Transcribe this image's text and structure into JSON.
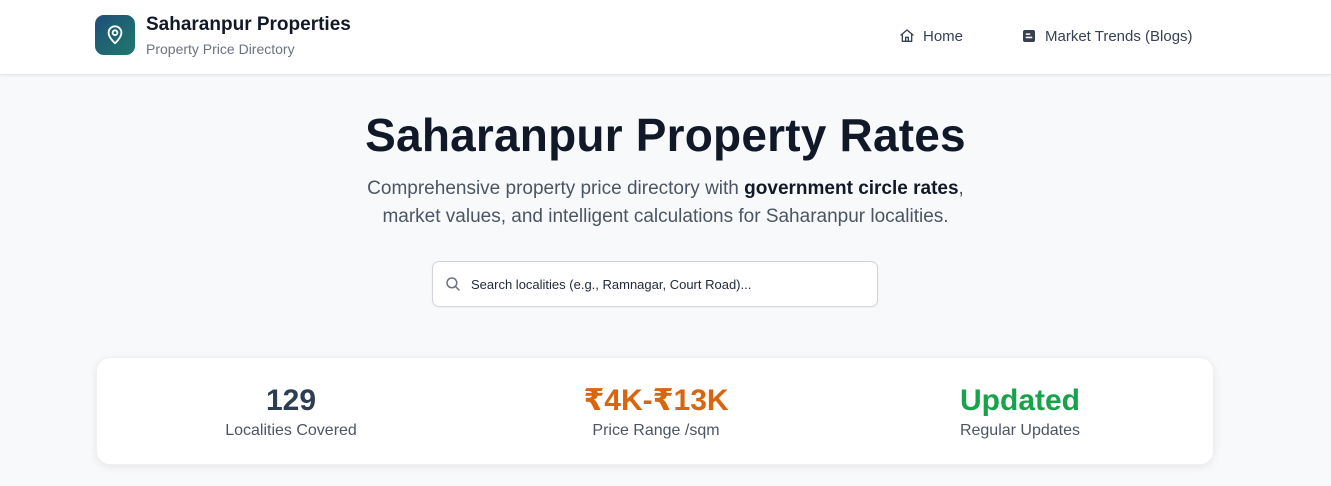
{
  "header": {
    "brand_title": "Saharanpur Properties",
    "brand_subtitle": "Property Price Directory",
    "logo_icon": "map-pin-icon",
    "nav": [
      {
        "label": "Home",
        "icon": "home-icon"
      },
      {
        "label": "Market Trends (Blogs)",
        "icon": "blog-icon"
      }
    ]
  },
  "hero": {
    "title": "Saharanpur Property Rates",
    "desc_before": "Comprehensive property price directory with ",
    "desc_bold": "government circle rates",
    "desc_after": ",",
    "desc_line2": "market values, and intelligent calculations for Saharanpur localities."
  },
  "search": {
    "placeholder": "Search localities (e.g., Ramnagar, Court Road)...",
    "icon": "search-icon"
  },
  "stats": [
    {
      "value": "129",
      "label": "Localities Covered",
      "color": "#2d3e50"
    },
    {
      "value": "₹4K-₹13K",
      "label": "Price Range /sqm",
      "color": "#d9650f"
    },
    {
      "value": "Updated",
      "label": "Regular Updates",
      "color": "#16a34a"
    }
  ],
  "colors": {
    "brand_gradient_start": "#1f4e79",
    "brand_gradient_end": "#1f7a6c",
    "background": "#f8f9fb"
  }
}
